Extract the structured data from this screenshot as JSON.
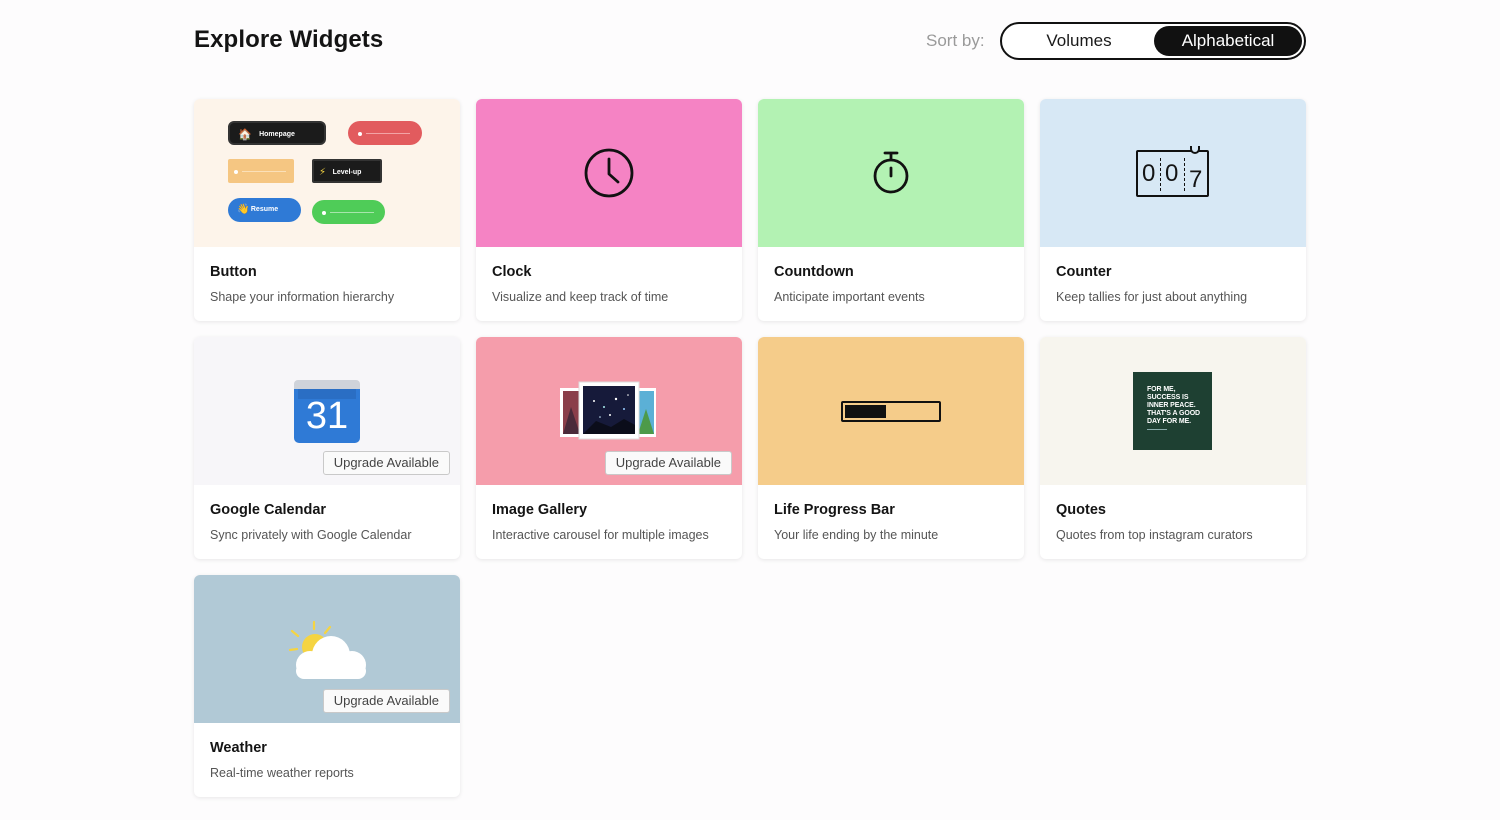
{
  "header": {
    "title": "Explore Widgets",
    "sort_label": "Sort by:",
    "sort_options": [
      "Volumes",
      "Alphabetical"
    ],
    "sort_selected": "Alphabetical"
  },
  "upgrade_label": "Upgrade Available",
  "widgets": [
    {
      "title": "Button",
      "description": "Shape your information hierarchy",
      "color": "#fdf4ea",
      "upgrade": false,
      "preview": {
        "homepage": "Homepage",
        "levelup": "Level-up",
        "resume": "Resume"
      }
    },
    {
      "title": "Clock",
      "description": "Visualize and keep track of time",
      "color": "#f583c4",
      "upgrade": false
    },
    {
      "title": "Countdown",
      "description": "Anticipate important events",
      "color": "#b3f2b3",
      "upgrade": false
    },
    {
      "title": "Counter",
      "description": "Keep tallies for just about anything",
      "color": "#d7e8f5",
      "upgrade": false,
      "preview": {
        "digits": [
          "0",
          "0",
          "7"
        ]
      }
    },
    {
      "title": "Google Calendar",
      "description": "Sync privately with Google Calendar",
      "color": "#f7f6f9",
      "upgrade": true,
      "preview": {
        "date": "31"
      }
    },
    {
      "title": "Image Gallery",
      "description": "Interactive carousel for multiple images",
      "color": "#f59dab",
      "upgrade": true
    },
    {
      "title": "Life Progress Bar",
      "description": "Your life ending by the minute",
      "color": "#f5cc8a",
      "upgrade": false,
      "preview": {
        "progress": 0.45
      }
    },
    {
      "title": "Quotes",
      "description": "Quotes from top instagram curators",
      "color": "#f7f5ee",
      "upgrade": false,
      "preview": {
        "quote": "FOR ME, SUCCESS IS INNER PEACE. THAT'S A GOOD DAY FOR ME."
      }
    },
    {
      "title": "Weather",
      "description": "Real-time weather reports",
      "color": "#b1c9d6",
      "upgrade": true
    }
  ]
}
